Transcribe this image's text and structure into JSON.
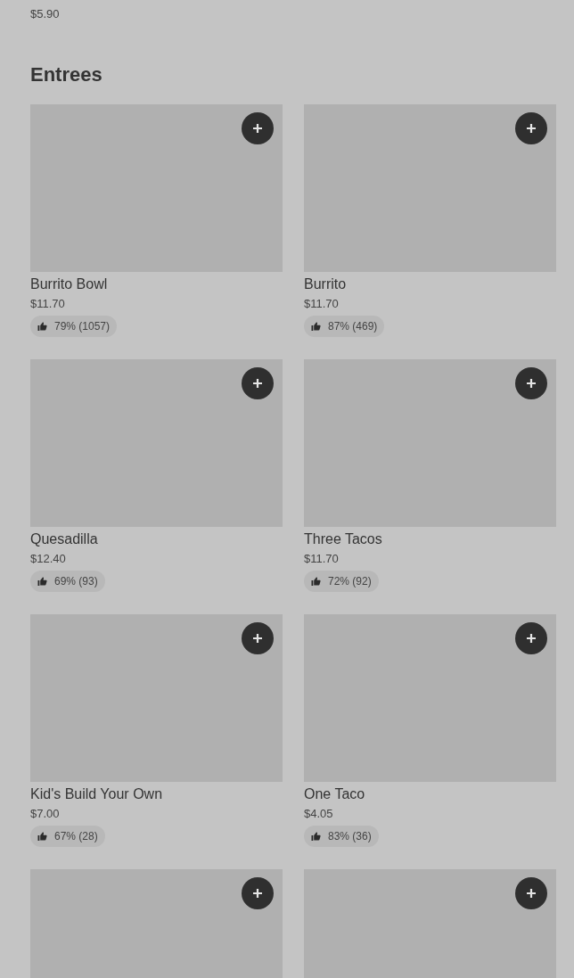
{
  "previous_section": {
    "price": "$5.90"
  },
  "section": {
    "title": "Entrees",
    "items": [
      {
        "kind": "full",
        "name": "Burrito Bowl",
        "price": "$11.70",
        "rating": "79% (1057)"
      },
      {
        "kind": "full",
        "name": "Burrito",
        "price": "$11.70",
        "rating": "87% (469)"
      },
      {
        "kind": "full",
        "name": "Quesadilla",
        "price": "$12.40",
        "rating": "69% (93)"
      },
      {
        "kind": "full",
        "name": "Three Tacos",
        "price": "$11.70",
        "rating": "72% (92)"
      },
      {
        "kind": "full",
        "name": "Kid's Build Your Own",
        "price": "$7.00",
        "rating": "67% (28)"
      },
      {
        "kind": "full",
        "name": "One Taco",
        "price": "$4.05",
        "rating": "83% (36)"
      },
      {
        "kind": "image-only"
      },
      {
        "kind": "image-only"
      }
    ]
  }
}
